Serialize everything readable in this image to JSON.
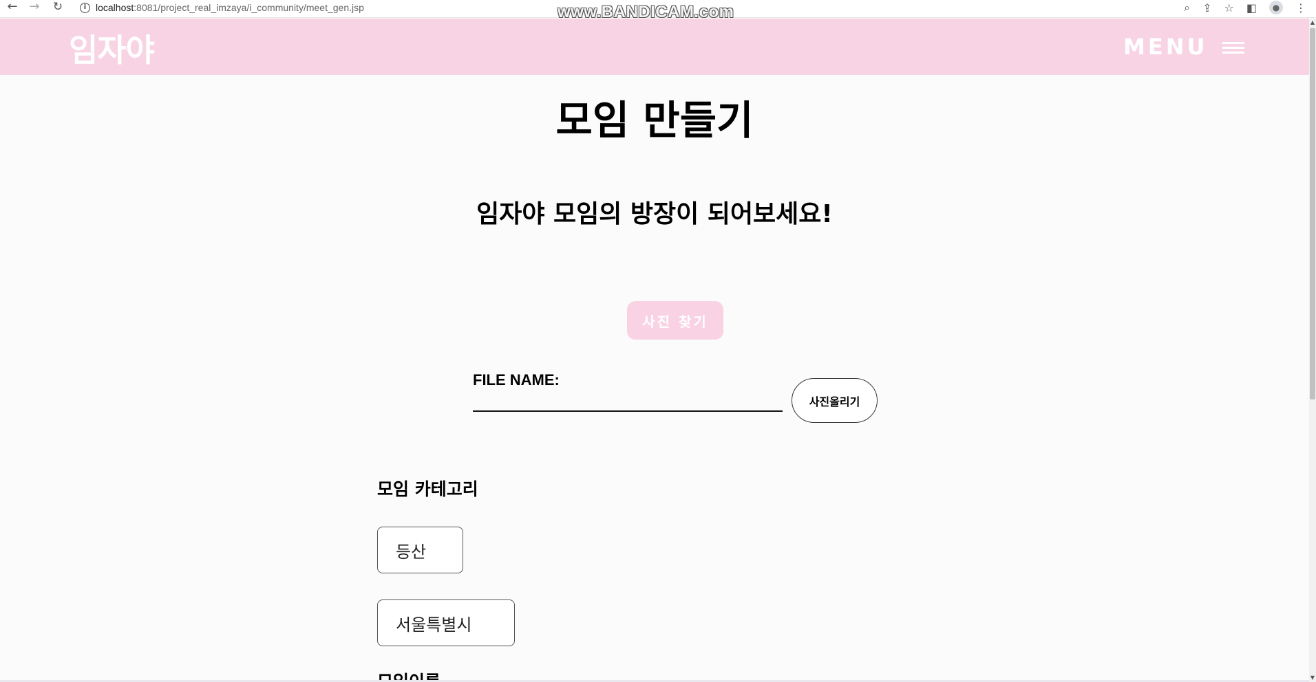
{
  "browser": {
    "back_icon": "←",
    "forward_icon": "→",
    "reload_icon": "↻",
    "info_icon": "i",
    "url_host": "localhost",
    "url_path": ":8081/project_real_imzaya/i_community/meet_gen.jsp",
    "watermark": "www.BANDICAM.com"
  },
  "header": {
    "logo": "임자야",
    "menu_label": "MENU",
    "background_color": "#f8d3e3"
  },
  "main": {
    "title": "모임 만들기",
    "subtitle": "임자야 모임의 방장이 되어보세요!",
    "find_photo_button": "사진 찾기",
    "file_name_label": "FILE NAME:",
    "file_name_value": "",
    "upload_button": "사진올리기",
    "category_label": "모임 카테고리",
    "category_choice": "등산",
    "region_choice": "서울특별시",
    "next_label_partial": "모임이름"
  }
}
